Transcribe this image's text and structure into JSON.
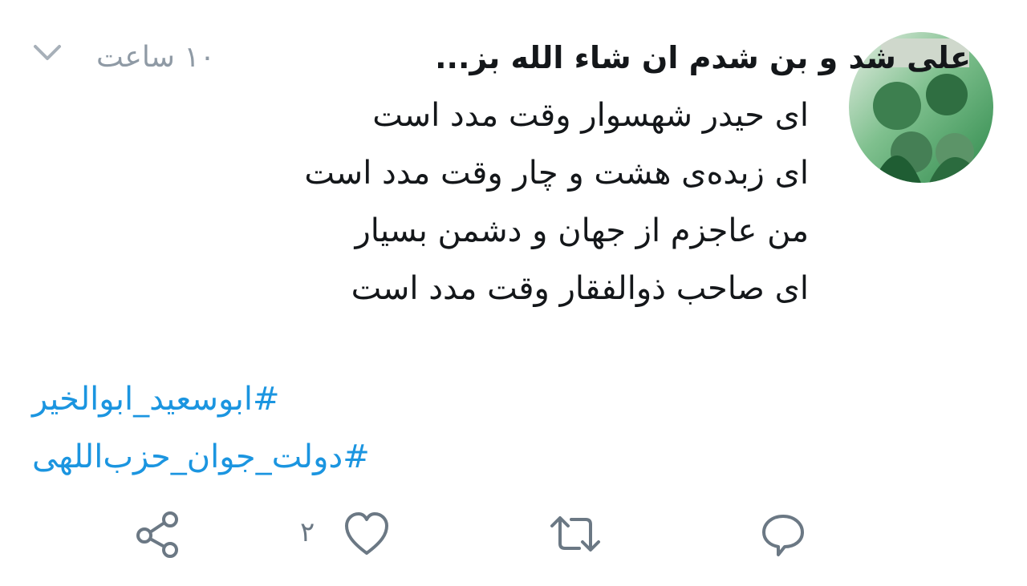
{
  "tweet": {
    "author_name": "علی شد و بن شدم ان شاء الله بز...",
    "timestamp": "۱۰ ساعت",
    "lines": [
      "ای حیدر شهسوار وقت مدد است",
      "ای زبده‌ی هشت و چار وقت مدد است",
      "من عاجزم از جهان و دشمن بسیار",
      "ای صاحب ذوالفقار وقت مدد است"
    ],
    "hashtags": [
      "#ابوسعید_ابوالخیر",
      "#دولت_جوان_حزب‌اللهی"
    ]
  },
  "actions": {
    "reply_icon": "reply-icon",
    "retweet_icon": "retweet-icon",
    "like_icon": "heart-icon",
    "like_count": "۲",
    "share_icon": "share-icon"
  },
  "colors": {
    "text": "#14171a",
    "muted": "#8f9aa5",
    "link": "#1b95e0",
    "icon": "#6b7884"
  }
}
